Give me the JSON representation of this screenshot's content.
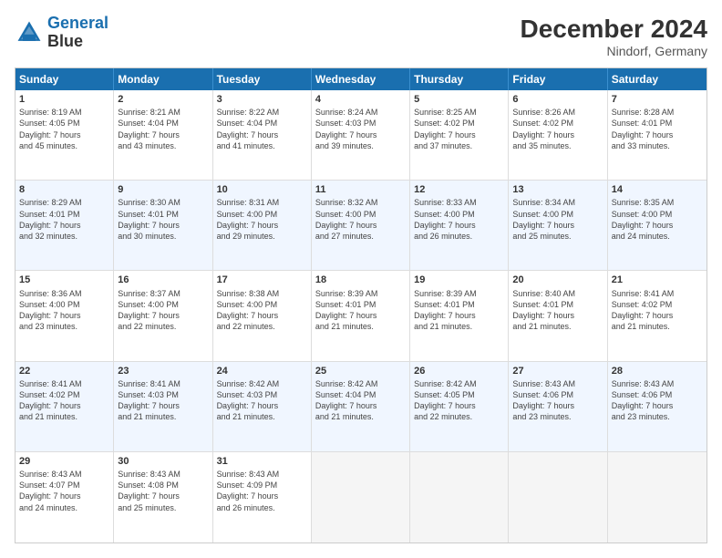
{
  "header": {
    "logo_line1": "General",
    "logo_line2": "Blue",
    "title": "December 2024",
    "subtitle": "Nindorf, Germany"
  },
  "calendar": {
    "days": [
      "Sunday",
      "Monday",
      "Tuesday",
      "Wednesday",
      "Thursday",
      "Friday",
      "Saturday"
    ],
    "rows": [
      [
        {
          "day": "1",
          "info": "Sunrise: 8:19 AM\nSunset: 4:05 PM\nDaylight: 7 hours\nand 45 minutes."
        },
        {
          "day": "2",
          "info": "Sunrise: 8:21 AM\nSunset: 4:04 PM\nDaylight: 7 hours\nand 43 minutes."
        },
        {
          "day": "3",
          "info": "Sunrise: 8:22 AM\nSunset: 4:04 PM\nDaylight: 7 hours\nand 41 minutes."
        },
        {
          "day": "4",
          "info": "Sunrise: 8:24 AM\nSunset: 4:03 PM\nDaylight: 7 hours\nand 39 minutes."
        },
        {
          "day": "5",
          "info": "Sunrise: 8:25 AM\nSunset: 4:02 PM\nDaylight: 7 hours\nand 37 minutes."
        },
        {
          "day": "6",
          "info": "Sunrise: 8:26 AM\nSunset: 4:02 PM\nDaylight: 7 hours\nand 35 minutes."
        },
        {
          "day": "7",
          "info": "Sunrise: 8:28 AM\nSunset: 4:01 PM\nDaylight: 7 hours\nand 33 minutes."
        }
      ],
      [
        {
          "day": "8",
          "info": "Sunrise: 8:29 AM\nSunset: 4:01 PM\nDaylight: 7 hours\nand 32 minutes."
        },
        {
          "day": "9",
          "info": "Sunrise: 8:30 AM\nSunset: 4:01 PM\nDaylight: 7 hours\nand 30 minutes."
        },
        {
          "day": "10",
          "info": "Sunrise: 8:31 AM\nSunset: 4:00 PM\nDaylight: 7 hours\nand 29 minutes."
        },
        {
          "day": "11",
          "info": "Sunrise: 8:32 AM\nSunset: 4:00 PM\nDaylight: 7 hours\nand 27 minutes."
        },
        {
          "day": "12",
          "info": "Sunrise: 8:33 AM\nSunset: 4:00 PM\nDaylight: 7 hours\nand 26 minutes."
        },
        {
          "day": "13",
          "info": "Sunrise: 8:34 AM\nSunset: 4:00 PM\nDaylight: 7 hours\nand 25 minutes."
        },
        {
          "day": "14",
          "info": "Sunrise: 8:35 AM\nSunset: 4:00 PM\nDaylight: 7 hours\nand 24 minutes."
        }
      ],
      [
        {
          "day": "15",
          "info": "Sunrise: 8:36 AM\nSunset: 4:00 PM\nDaylight: 7 hours\nand 23 minutes."
        },
        {
          "day": "16",
          "info": "Sunrise: 8:37 AM\nSunset: 4:00 PM\nDaylight: 7 hours\nand 22 minutes."
        },
        {
          "day": "17",
          "info": "Sunrise: 8:38 AM\nSunset: 4:00 PM\nDaylight: 7 hours\nand 22 minutes."
        },
        {
          "day": "18",
          "info": "Sunrise: 8:39 AM\nSunset: 4:01 PM\nDaylight: 7 hours\nand 21 minutes."
        },
        {
          "day": "19",
          "info": "Sunrise: 8:39 AM\nSunset: 4:01 PM\nDaylight: 7 hours\nand 21 minutes."
        },
        {
          "day": "20",
          "info": "Sunrise: 8:40 AM\nSunset: 4:01 PM\nDaylight: 7 hours\nand 21 minutes."
        },
        {
          "day": "21",
          "info": "Sunrise: 8:41 AM\nSunset: 4:02 PM\nDaylight: 7 hours\nand 21 minutes."
        }
      ],
      [
        {
          "day": "22",
          "info": "Sunrise: 8:41 AM\nSunset: 4:02 PM\nDaylight: 7 hours\nand 21 minutes."
        },
        {
          "day": "23",
          "info": "Sunrise: 8:41 AM\nSunset: 4:03 PM\nDaylight: 7 hours\nand 21 minutes."
        },
        {
          "day": "24",
          "info": "Sunrise: 8:42 AM\nSunset: 4:03 PM\nDaylight: 7 hours\nand 21 minutes."
        },
        {
          "day": "25",
          "info": "Sunrise: 8:42 AM\nSunset: 4:04 PM\nDaylight: 7 hours\nand 21 minutes."
        },
        {
          "day": "26",
          "info": "Sunrise: 8:42 AM\nSunset: 4:05 PM\nDaylight: 7 hours\nand 22 minutes."
        },
        {
          "day": "27",
          "info": "Sunrise: 8:43 AM\nSunset: 4:06 PM\nDaylight: 7 hours\nand 23 minutes."
        },
        {
          "day": "28",
          "info": "Sunrise: 8:43 AM\nSunset: 4:06 PM\nDaylight: 7 hours\nand 23 minutes."
        }
      ],
      [
        {
          "day": "29",
          "info": "Sunrise: 8:43 AM\nSunset: 4:07 PM\nDaylight: 7 hours\nand 24 minutes."
        },
        {
          "day": "30",
          "info": "Sunrise: 8:43 AM\nSunset: 4:08 PM\nDaylight: 7 hours\nand 25 minutes."
        },
        {
          "day": "31",
          "info": "Sunrise: 8:43 AM\nSunset: 4:09 PM\nDaylight: 7 hours\nand 26 minutes."
        },
        {
          "day": "",
          "info": ""
        },
        {
          "day": "",
          "info": ""
        },
        {
          "day": "",
          "info": ""
        },
        {
          "day": "",
          "info": ""
        }
      ]
    ]
  }
}
